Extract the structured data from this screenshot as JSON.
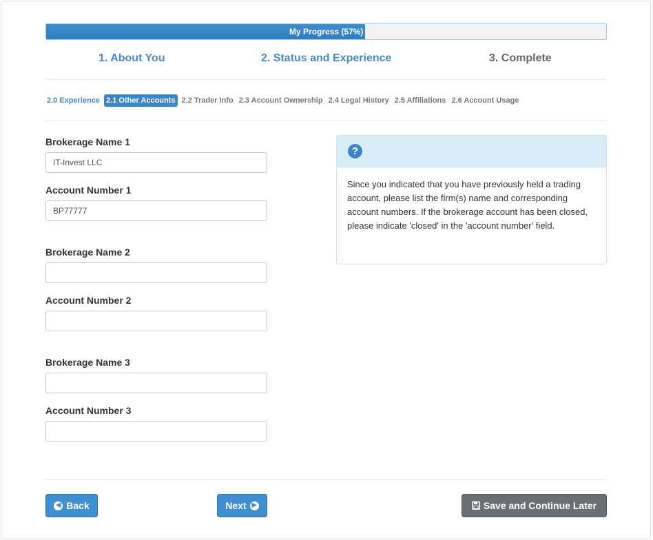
{
  "progress": {
    "label": "My Progress (57%)",
    "percent": 57
  },
  "steps": [
    {
      "label": "1. About You",
      "state": "done"
    },
    {
      "label": "2. Status and Experience",
      "state": "current"
    },
    {
      "label": "3. Complete",
      "state": "todo"
    }
  ],
  "subtabs": [
    {
      "label": "2.0 Experience",
      "state": "done"
    },
    {
      "label": "2.1 Other Accounts",
      "state": "active"
    },
    {
      "label": "2.2 Trader Info",
      "state": "todo"
    },
    {
      "label": "2.3 Account Ownership",
      "state": "todo"
    },
    {
      "label": "2.4 Legal History",
      "state": "todo"
    },
    {
      "label": "2.5 Affiliations",
      "state": "todo"
    },
    {
      "label": "2.6 Account Usage",
      "state": "todo"
    }
  ],
  "form": {
    "brokerage_1": {
      "label": "Brokerage Name 1",
      "value": "IT-Invest LLC"
    },
    "account_1": {
      "label": "Account Number 1",
      "value": "BP77777"
    },
    "brokerage_2": {
      "label": "Brokerage Name 2",
      "value": ""
    },
    "account_2": {
      "label": "Account Number 2",
      "value": ""
    },
    "brokerage_3": {
      "label": "Brokerage Name 3",
      "value": ""
    },
    "account_3": {
      "label": "Account Number 3",
      "value": ""
    }
  },
  "help": {
    "icon": "question-circle-icon",
    "text": "Since you indicated that you have previously held a trading account, please list the firm(s) name and corresponding account numbers. If the brokerage account has been closed, please indicate 'closed' in the 'account number' field."
  },
  "buttons": {
    "back": "Back",
    "next": "Next",
    "save": "Save and Continue Later"
  },
  "colors": {
    "accent": "#3a86c8",
    "progress_fill": "#2f7dbf",
    "help_bg": "#d9edf7",
    "save_button": "#6b6e72"
  }
}
